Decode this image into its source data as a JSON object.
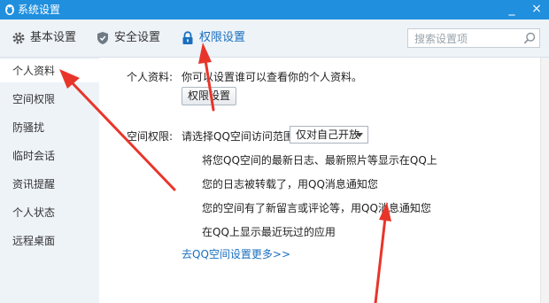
{
  "window": {
    "title": "系统设置",
    "minimize_label": "_",
    "close_label": "×"
  },
  "toolbar": {
    "tabs": [
      {
        "label": "基本设置",
        "icon": "gear-icon"
      },
      {
        "label": "安全设置",
        "icon": "shield-icon"
      },
      {
        "label": "权限设置",
        "icon": "lock-icon",
        "active": true
      }
    ],
    "search": {
      "placeholder": "搜索设置项",
      "value": ""
    }
  },
  "sidebar": {
    "items": [
      {
        "label": "个人资料",
        "active": true
      },
      {
        "label": "空间权限"
      },
      {
        "label": "防骚扰"
      },
      {
        "label": "临时会话"
      },
      {
        "label": "资讯提醒"
      },
      {
        "label": "个人状态"
      },
      {
        "label": "远程桌面"
      }
    ]
  },
  "profile": {
    "label": "个人资料:",
    "description": "你可以设置谁可以查看你的个人资料。",
    "button_label": "权限设置"
  },
  "space": {
    "label": "空间权限:",
    "prompt": "请选择QQ空间访问范围:",
    "selected": "仅对自己开放",
    "notices": [
      "将您QQ空间的最新日志、最新照片等显示在QQ上",
      "您的日志被转载了，用QQ消息通知您",
      "您的空间有了新留言或评论等，用QQ消息通知您",
      "在QQ上显示最近玩过的应用"
    ],
    "more_link": "去QQ空间设置更多>>"
  },
  "colors": {
    "titlebar": "#1f8fde",
    "accent": "#1a6fbf",
    "panel_bg": "#eef3f8",
    "annotation_arrow": "#e8352a"
  }
}
